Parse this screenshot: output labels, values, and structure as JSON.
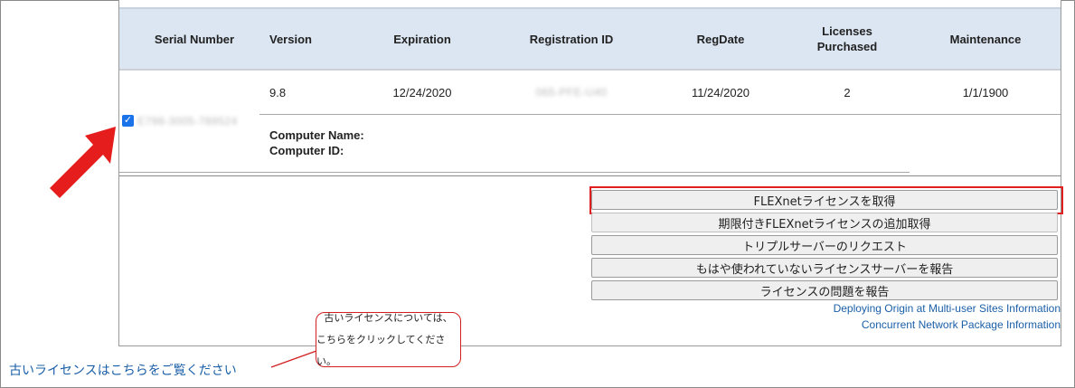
{
  "table": {
    "headers": {
      "serial_number": "Serial Number",
      "version": "Version",
      "expiration": "Expiration",
      "registration_id": "Registration ID",
      "regdate": "RegDate",
      "licenses_purchased_line1": "Licenses",
      "licenses_purchased_line2": "Purchased",
      "maintenance": "Maintenance"
    },
    "row": {
      "serial_number": "E798-3005-789524",
      "version": "9.8",
      "expiration": "12/24/2020",
      "registration_id": "065-PFE-U40",
      "regdate": "11/24/2020",
      "licenses_purchased": "2",
      "maintenance": "1/1/1900",
      "checked": true,
      "computer_name_label": "Computer Name:",
      "computer_id_label": "Computer ID:"
    }
  },
  "actions": {
    "get_flexnet_license": "FLEXnetライセンスを取得",
    "additional_timed_license": "期限付きFLEXnetライセンスの追加取得",
    "triple_server_request": "トリプルサーバーのリクエスト",
    "report_unused_license_server": "もはや使われていないライセンスサーバーを報告",
    "report_license_problem": "ライセンスの問題を報告"
  },
  "links": {
    "deploying_origin": "Deploying Origin at Multi-user Sites Information",
    "concurrent_network": "Concurrent Network Package Information",
    "old_licenses": "古いライセンスはこちらをご覧ください"
  },
  "callout": {
    "line1": "古いライセンスについては、",
    "line2": "こちらをクリックしてください。"
  },
  "colors": {
    "header_bg": "#dce6f2",
    "accent_red": "#e02020",
    "link_blue": "#1a5fa8",
    "checkbox_blue": "#1a73e8"
  }
}
